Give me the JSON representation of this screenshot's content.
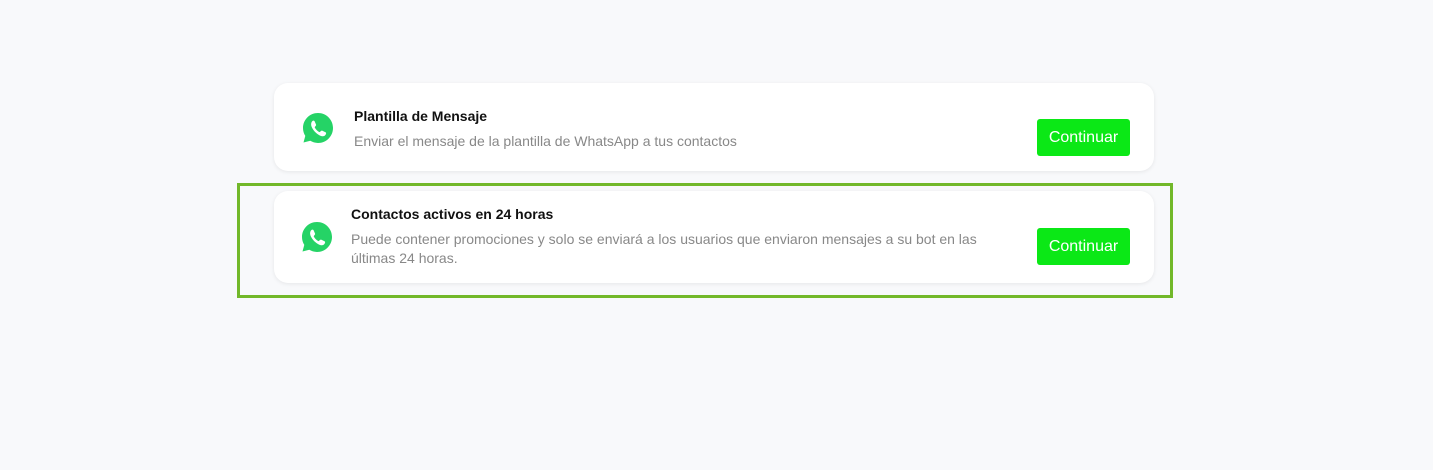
{
  "options": [
    {
      "title": "Plantilla de Mensaje",
      "description": "Enviar el mensaje de la plantilla de WhatsApp a tus contactos",
      "button_label": "Continuar",
      "icon": "whatsapp-icon"
    },
    {
      "title": "Contactos activos en 24 horas",
      "description": "Puede contener promociones y solo se enviará a los usuarios que enviaron mensajes a su bot en las últimas 24 horas.",
      "button_label": "Continuar",
      "icon": "whatsapp-icon",
      "selected": true
    }
  ],
  "colors": {
    "accent_button": "#0be816",
    "whatsapp_green": "#25d366",
    "selection_border": "#72b82a",
    "background": "#f8f9fb"
  }
}
